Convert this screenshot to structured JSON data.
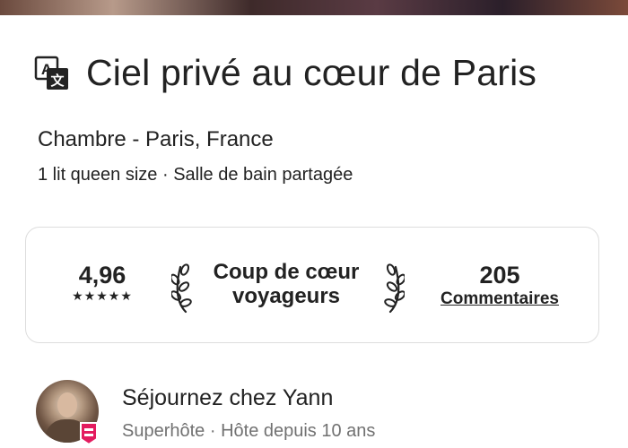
{
  "listing": {
    "title": "Ciel privé au cœur de Paris",
    "location": "Chambre - Paris, France",
    "details": "1 lit queen size · Salle de bain partagée"
  },
  "stats": {
    "rating_value": "4,96",
    "rating_stars": "★★★★★",
    "guest_favorite_line1": "Coup de cœur",
    "guest_favorite_line2": "voyageurs",
    "reviews_count": "205",
    "reviews_label": "Commentaires"
  },
  "host": {
    "name": "Séjournez chez Yann",
    "info": "Superhôte · Hôte depuis 10 ans"
  },
  "colors": {
    "text_primary": "#222222",
    "text_secondary": "#717171",
    "card_border": "#dddddd",
    "superhost_badge": "#e31c5f"
  },
  "icons": {
    "translate": "translate-icon",
    "laurel_left": "laurel-left-icon",
    "laurel_right": "laurel-right-icon",
    "superhost": "superhost-badge-icon"
  }
}
